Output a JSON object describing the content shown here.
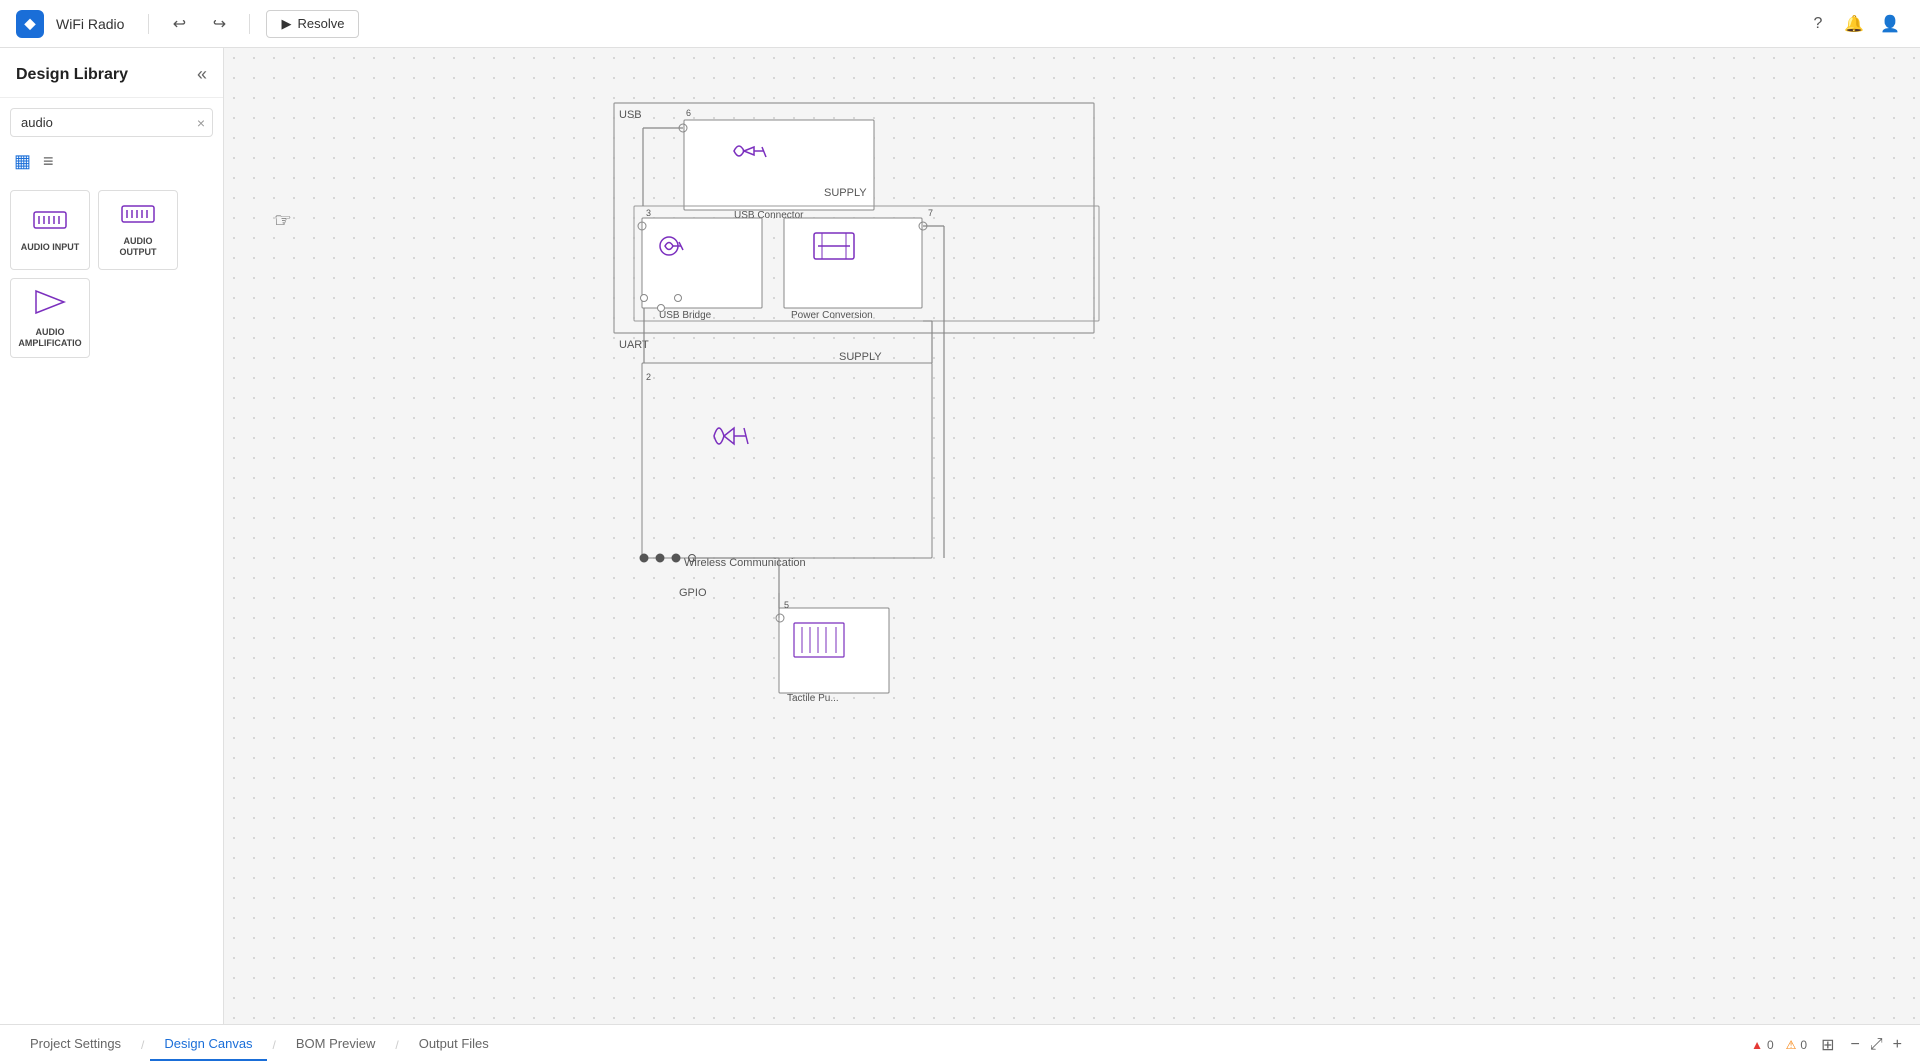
{
  "app": {
    "logo_text": "◆",
    "project_name": "WiFi Radio",
    "resolve_label": "Resolve"
  },
  "topbar": {
    "undo_icon": "↩",
    "redo_icon": "↪",
    "resolve_play": "▶",
    "help_icon": "?",
    "bell_icon": "🔔",
    "user_icon": "👤"
  },
  "sidebar": {
    "title": "Design Library",
    "collapse_icon": "«",
    "search_value": "audio",
    "search_clear": "×",
    "view_grid_icon": "▦",
    "view_list_icon": "≡",
    "components": [
      {
        "label": "AUDIO INPUT",
        "icon": "⌨"
      },
      {
        "label": "AUDIO OUTPUT",
        "icon": "⌨"
      },
      {
        "label": "AUDIO AMPLIFICATIO",
        "icon": "▷"
      }
    ]
  },
  "diagram": {
    "blocks": {
      "usb_area_label": "USB",
      "supply_label_top": "SUPPLY",
      "supply_label_bottom": "SUPPLY",
      "uart_label": "UART",
      "gpio_label": "GPIO",
      "usb_connector_label": "USB Connector",
      "usb_bridge_label": "USB Bridge",
      "power_conversion_label": "Power Conversion",
      "wireless_comm_label": "Wireless Communication",
      "tactile_label": "Tactile Pu...",
      "node_6": "6",
      "node_3": "3",
      "node_7": "7",
      "node_2": "2",
      "node_5": "5"
    }
  },
  "bottombar": {
    "tabs": [
      {
        "label": "Project Settings",
        "active": false
      },
      {
        "label": "Design Canvas",
        "active": true
      },
      {
        "label": "BOM Preview",
        "active": false
      },
      {
        "label": "Output Files",
        "active": false
      }
    ],
    "error_count": "0",
    "warning_count": "0",
    "grid_icon": "⊞",
    "zoom_out_icon": "−",
    "fit_icon": "⤢",
    "zoom_in_icon": "+"
  }
}
